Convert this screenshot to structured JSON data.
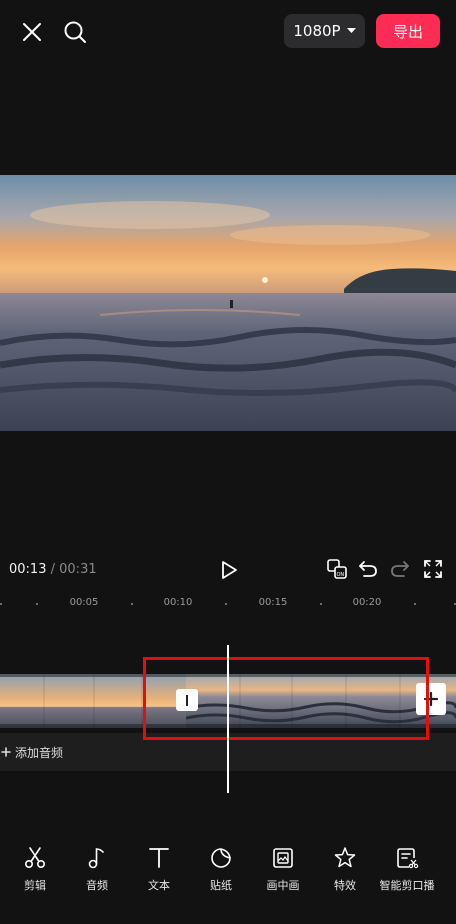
{
  "topbar": {
    "resolution": "1080P",
    "export_label": "导出"
  },
  "playback": {
    "current_time": "00:13",
    "separator": "/",
    "total_time": "00:31"
  },
  "ruler": {
    "labels": [
      "00:05",
      "00:10",
      "00:15",
      "00:20"
    ]
  },
  "audio": {
    "add_label": "添加音频"
  },
  "toolbar": {
    "items": [
      {
        "label": "剪辑",
        "icon": "scissors-icon"
      },
      {
        "label": "音频",
        "icon": "music-note-icon"
      },
      {
        "label": "文本",
        "icon": "text-icon"
      },
      {
        "label": "贴纸",
        "icon": "sticker-icon"
      },
      {
        "label": "画中画",
        "icon": "picture-in-picture-icon"
      },
      {
        "label": "特效",
        "icon": "effects-star-icon"
      },
      {
        "label": "智能剪口播",
        "icon": "smart-cut-icon"
      }
    ]
  },
  "colors": {
    "accent": "#fe2c55",
    "highlight": "#e01010",
    "background": "#121212"
  }
}
